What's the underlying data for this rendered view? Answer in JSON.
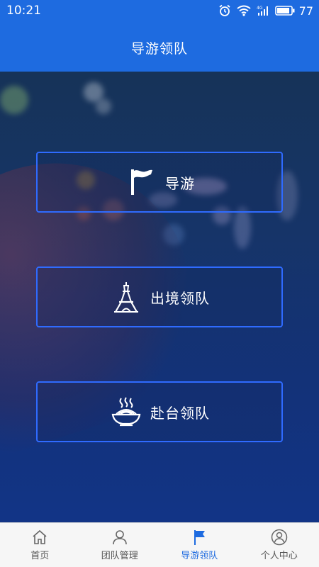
{
  "status_bar": {
    "time": "10:21",
    "battery": "77",
    "icons": [
      "alarm-icon",
      "wifi-icon",
      "signal-4g-icon",
      "battery-icon"
    ]
  },
  "header": {
    "title": "导游领队"
  },
  "options": [
    {
      "label": "导游",
      "icon": "flag-icon"
    },
    {
      "label": "出境领队",
      "icon": "eiffel-tower-icon"
    },
    {
      "label": "赴台领队",
      "icon": "noodle-bowl-icon"
    }
  ],
  "bottom_nav": {
    "items": [
      {
        "label": "首页",
        "icon": "home-icon",
        "active": false
      },
      {
        "label": "团队管理",
        "icon": "user-icon",
        "active": false
      },
      {
        "label": "导游领队",
        "icon": "flag-icon",
        "active": true
      },
      {
        "label": "个人中心",
        "icon": "profile-icon",
        "active": false
      }
    ]
  },
  "colors": {
    "accent": "#1e6be0",
    "button_border": "#2f6bff",
    "nav_background": "#f6f6f6"
  }
}
